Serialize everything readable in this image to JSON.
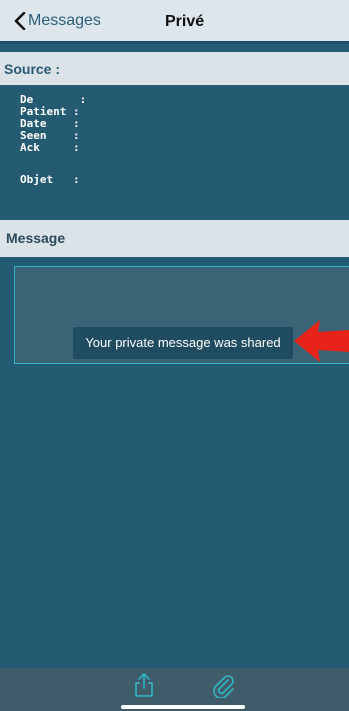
{
  "navbar": {
    "back_label": "Messages",
    "title": "Privé"
  },
  "source": {
    "label": "Source :"
  },
  "fields": [
    {
      "label": "De",
      "text": "De       :"
    },
    {
      "label": "Patient",
      "text": "Patient :"
    },
    {
      "label": "Date",
      "text": "Date    :"
    },
    {
      "label": "Seen",
      "text": "Seen    :"
    },
    {
      "label": "Ack",
      "text": "Ack     :"
    }
  ],
  "object_field": {
    "label": "Objet",
    "text": "Objet   :"
  },
  "message": {
    "label": "Message",
    "body": ""
  },
  "toast": {
    "text": "Your private message was shared"
  },
  "toolbar": {
    "buttons": [
      {
        "name": "share-icon"
      },
      {
        "name": "paperclip-icon"
      }
    ]
  },
  "colors": {
    "background": "#255a73",
    "header_bar": "#dbe3e8",
    "accent": "#33b6c4",
    "arrow": "#e8231a"
  }
}
